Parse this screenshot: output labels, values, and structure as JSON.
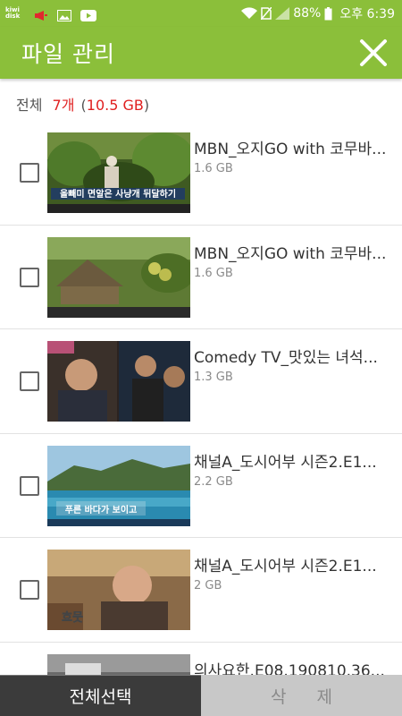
{
  "status_bar": {
    "app_badge": "kiwi disk",
    "battery_percent": "88%",
    "time": "오후 6:39",
    "icons": [
      "kiwi-disk-icon",
      "megaphone-icon",
      "image-icon",
      "youtube-icon",
      "wifi-icon",
      "no-sim-icon",
      "signal-icon",
      "battery-icon"
    ]
  },
  "header": {
    "title": "파일 관리",
    "close_icon": "close-icon"
  },
  "summary": {
    "label": "전체",
    "count": "7개",
    "size_open": "(",
    "size": "10.5 GB",
    "size_close": ")"
  },
  "files": [
    {
      "title": "MBN_오지GO with 코무바...",
      "size": "1.6 GB",
      "caption": "올빼미 면알은 사냥개 뒤달하기"
    },
    {
      "title": "MBN_오지GO with 코무바...",
      "size": "1.6 GB",
      "caption": ""
    },
    {
      "title": "Comedy TV_맛있는 녀석...",
      "size": "1.3 GB",
      "caption": ""
    },
    {
      "title": "채널A_도시어부 시즌2.E1...",
      "size": "2.2 GB",
      "caption": "푸른 바다가 보이고"
    },
    {
      "title": "채널A_도시어부 시즌2.E1...",
      "size": "2 GB",
      "caption": "흐뭇"
    },
    {
      "title": "의사요한.E08.190810.36...",
      "size": "",
      "caption": ""
    }
  ],
  "bottom_bar": {
    "select_all": "전체선택",
    "delete": "삭 제"
  },
  "colors": {
    "primary": "#8bbf3a",
    "accent_red": "#e02020",
    "bottom_dark": "#3b3b3b",
    "bottom_disabled": "#c8c8c8"
  }
}
